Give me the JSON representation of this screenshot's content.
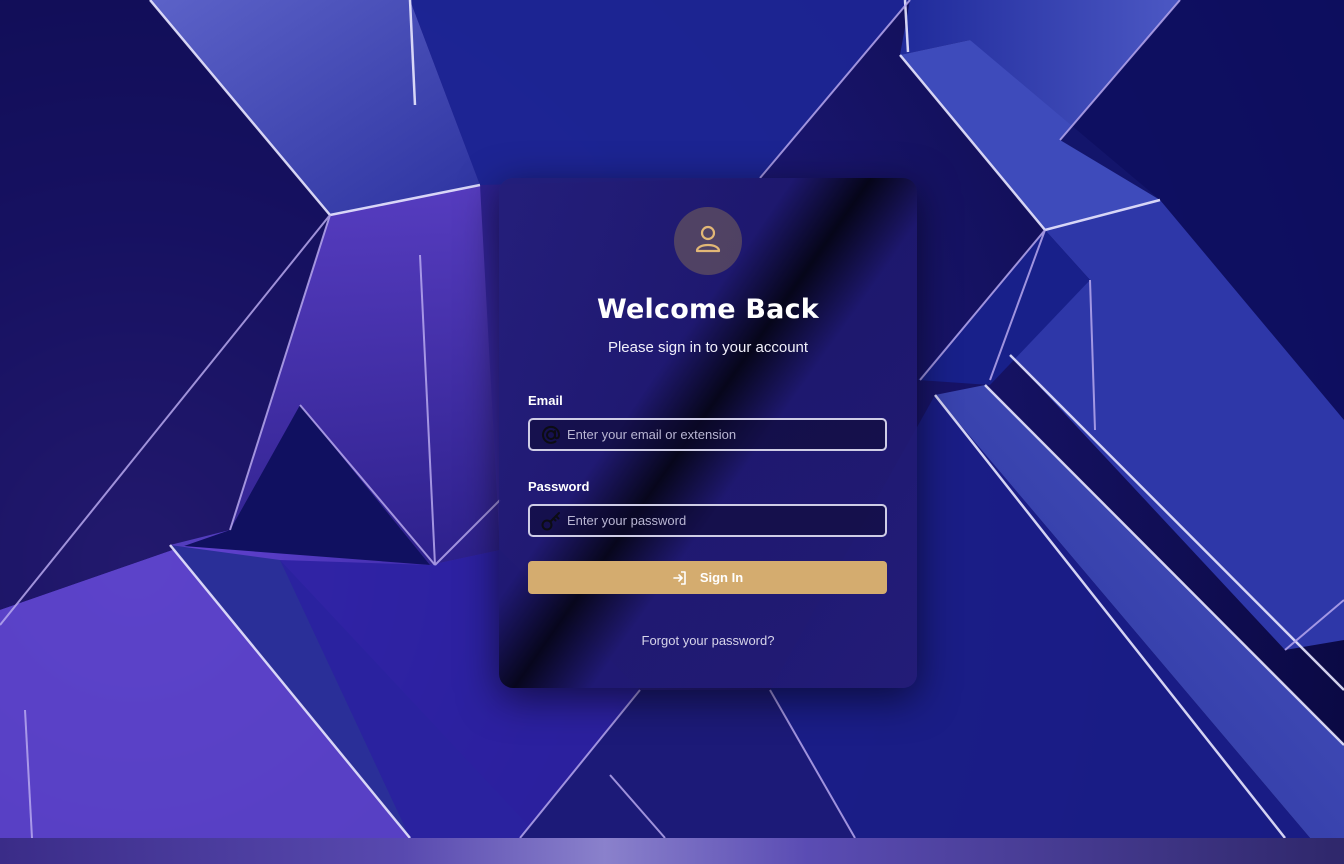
{
  "colors": {
    "accent": "#d4ac6f",
    "card_background": "#231e78",
    "background_primary": "#1a1670",
    "background_highlight": "#6a48d8"
  },
  "login": {
    "avatar_icon": "user-icon",
    "title": "Welcome Back",
    "subtitle": "Please sign in to your account",
    "email": {
      "label": "Email",
      "placeholder": "Enter your email or extension",
      "value": "",
      "icon": "at-sign-icon"
    },
    "password": {
      "label": "Password",
      "placeholder": "Enter your password",
      "value": "",
      "icon": "key-icon"
    },
    "sign_in": {
      "label": "Sign In",
      "icon": "sign-in-icon"
    },
    "forgot_password": "Forgot your password?"
  }
}
